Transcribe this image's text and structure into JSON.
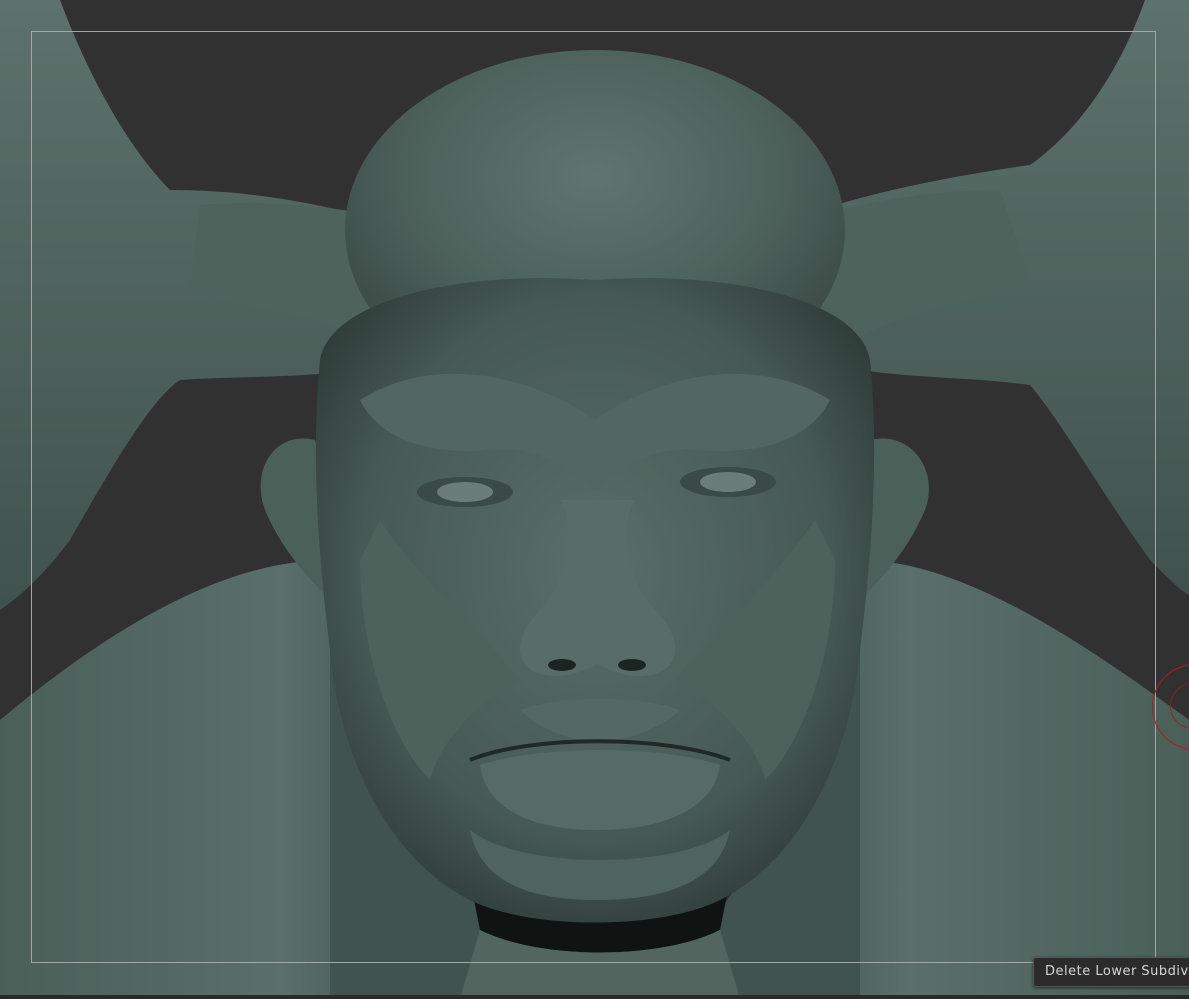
{
  "viewport": {
    "background_color": "#313131",
    "model_color": "#4f625d",
    "frame_color": "#a3a7a5"
  },
  "model": {
    "description_icon": "sculpted-ogre-head-model"
  },
  "brush_cursor": {
    "color": "#b01c1c"
  },
  "tooltip": {
    "text": "Delete Lower Subdiv"
  }
}
